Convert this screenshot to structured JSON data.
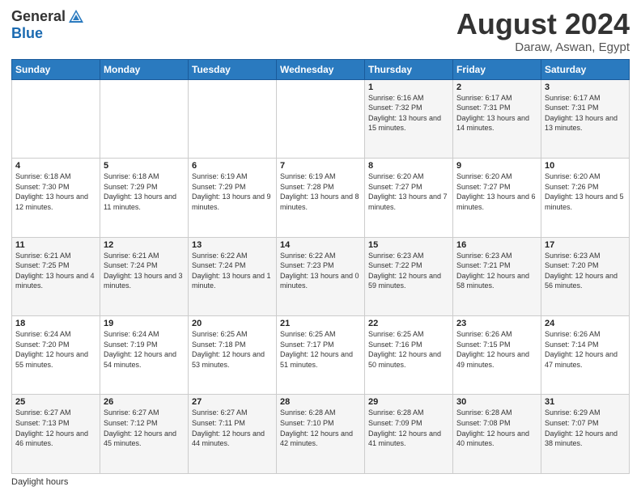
{
  "header": {
    "logo_general": "General",
    "logo_blue": "Blue",
    "month_title": "August 2024",
    "location": "Daraw, Aswan, Egypt"
  },
  "days_of_week": [
    "Sunday",
    "Monday",
    "Tuesday",
    "Wednesday",
    "Thursday",
    "Friday",
    "Saturday"
  ],
  "weeks": [
    [
      {
        "day": "",
        "sunrise": "",
        "sunset": "",
        "daylight": ""
      },
      {
        "day": "",
        "sunrise": "",
        "sunset": "",
        "daylight": ""
      },
      {
        "day": "",
        "sunrise": "",
        "sunset": "",
        "daylight": ""
      },
      {
        "day": "",
        "sunrise": "",
        "sunset": "",
        "daylight": ""
      },
      {
        "day": "1",
        "sunrise": "Sunrise: 6:16 AM",
        "sunset": "Sunset: 7:32 PM",
        "daylight": "Daylight: 13 hours and 15 minutes."
      },
      {
        "day": "2",
        "sunrise": "Sunrise: 6:17 AM",
        "sunset": "Sunset: 7:31 PM",
        "daylight": "Daylight: 13 hours and 14 minutes."
      },
      {
        "day": "3",
        "sunrise": "Sunrise: 6:17 AM",
        "sunset": "Sunset: 7:31 PM",
        "daylight": "Daylight: 13 hours and 13 minutes."
      }
    ],
    [
      {
        "day": "4",
        "sunrise": "Sunrise: 6:18 AM",
        "sunset": "Sunset: 7:30 PM",
        "daylight": "Daylight: 13 hours and 12 minutes."
      },
      {
        "day": "5",
        "sunrise": "Sunrise: 6:18 AM",
        "sunset": "Sunset: 7:29 PM",
        "daylight": "Daylight: 13 hours and 11 minutes."
      },
      {
        "day": "6",
        "sunrise": "Sunrise: 6:19 AM",
        "sunset": "Sunset: 7:29 PM",
        "daylight": "Daylight: 13 hours and 9 minutes."
      },
      {
        "day": "7",
        "sunrise": "Sunrise: 6:19 AM",
        "sunset": "Sunset: 7:28 PM",
        "daylight": "Daylight: 13 hours and 8 minutes."
      },
      {
        "day": "8",
        "sunrise": "Sunrise: 6:20 AM",
        "sunset": "Sunset: 7:27 PM",
        "daylight": "Daylight: 13 hours and 7 minutes."
      },
      {
        "day": "9",
        "sunrise": "Sunrise: 6:20 AM",
        "sunset": "Sunset: 7:27 PM",
        "daylight": "Daylight: 13 hours and 6 minutes."
      },
      {
        "day": "10",
        "sunrise": "Sunrise: 6:20 AM",
        "sunset": "Sunset: 7:26 PM",
        "daylight": "Daylight: 13 hours and 5 minutes."
      }
    ],
    [
      {
        "day": "11",
        "sunrise": "Sunrise: 6:21 AM",
        "sunset": "Sunset: 7:25 PM",
        "daylight": "Daylight: 13 hours and 4 minutes."
      },
      {
        "day": "12",
        "sunrise": "Sunrise: 6:21 AM",
        "sunset": "Sunset: 7:24 PM",
        "daylight": "Daylight: 13 hours and 3 minutes."
      },
      {
        "day": "13",
        "sunrise": "Sunrise: 6:22 AM",
        "sunset": "Sunset: 7:24 PM",
        "daylight": "Daylight: 13 hours and 1 minute."
      },
      {
        "day": "14",
        "sunrise": "Sunrise: 6:22 AM",
        "sunset": "Sunset: 7:23 PM",
        "daylight": "Daylight: 13 hours and 0 minutes."
      },
      {
        "day": "15",
        "sunrise": "Sunrise: 6:23 AM",
        "sunset": "Sunset: 7:22 PM",
        "daylight": "Daylight: 12 hours and 59 minutes."
      },
      {
        "day": "16",
        "sunrise": "Sunrise: 6:23 AM",
        "sunset": "Sunset: 7:21 PM",
        "daylight": "Daylight: 12 hours and 58 minutes."
      },
      {
        "day": "17",
        "sunrise": "Sunrise: 6:23 AM",
        "sunset": "Sunset: 7:20 PM",
        "daylight": "Daylight: 12 hours and 56 minutes."
      }
    ],
    [
      {
        "day": "18",
        "sunrise": "Sunrise: 6:24 AM",
        "sunset": "Sunset: 7:20 PM",
        "daylight": "Daylight: 12 hours and 55 minutes."
      },
      {
        "day": "19",
        "sunrise": "Sunrise: 6:24 AM",
        "sunset": "Sunset: 7:19 PM",
        "daylight": "Daylight: 12 hours and 54 minutes."
      },
      {
        "day": "20",
        "sunrise": "Sunrise: 6:25 AM",
        "sunset": "Sunset: 7:18 PM",
        "daylight": "Daylight: 12 hours and 53 minutes."
      },
      {
        "day": "21",
        "sunrise": "Sunrise: 6:25 AM",
        "sunset": "Sunset: 7:17 PM",
        "daylight": "Daylight: 12 hours and 51 minutes."
      },
      {
        "day": "22",
        "sunrise": "Sunrise: 6:25 AM",
        "sunset": "Sunset: 7:16 PM",
        "daylight": "Daylight: 12 hours and 50 minutes."
      },
      {
        "day": "23",
        "sunrise": "Sunrise: 6:26 AM",
        "sunset": "Sunset: 7:15 PM",
        "daylight": "Daylight: 12 hours and 49 minutes."
      },
      {
        "day": "24",
        "sunrise": "Sunrise: 6:26 AM",
        "sunset": "Sunset: 7:14 PM",
        "daylight": "Daylight: 12 hours and 47 minutes."
      }
    ],
    [
      {
        "day": "25",
        "sunrise": "Sunrise: 6:27 AM",
        "sunset": "Sunset: 7:13 PM",
        "daylight": "Daylight: 12 hours and 46 minutes."
      },
      {
        "day": "26",
        "sunrise": "Sunrise: 6:27 AM",
        "sunset": "Sunset: 7:12 PM",
        "daylight": "Daylight: 12 hours and 45 minutes."
      },
      {
        "day": "27",
        "sunrise": "Sunrise: 6:27 AM",
        "sunset": "Sunset: 7:11 PM",
        "daylight": "Daylight: 12 hours and 44 minutes."
      },
      {
        "day": "28",
        "sunrise": "Sunrise: 6:28 AM",
        "sunset": "Sunset: 7:10 PM",
        "daylight": "Daylight: 12 hours and 42 minutes."
      },
      {
        "day": "29",
        "sunrise": "Sunrise: 6:28 AM",
        "sunset": "Sunset: 7:09 PM",
        "daylight": "Daylight: 12 hours and 41 minutes."
      },
      {
        "day": "30",
        "sunrise": "Sunrise: 6:28 AM",
        "sunset": "Sunset: 7:08 PM",
        "daylight": "Daylight: 12 hours and 40 minutes."
      },
      {
        "day": "31",
        "sunrise": "Sunrise: 6:29 AM",
        "sunset": "Sunset: 7:07 PM",
        "daylight": "Daylight: 12 hours and 38 minutes."
      }
    ]
  ],
  "footer": {
    "note": "Daylight hours"
  }
}
